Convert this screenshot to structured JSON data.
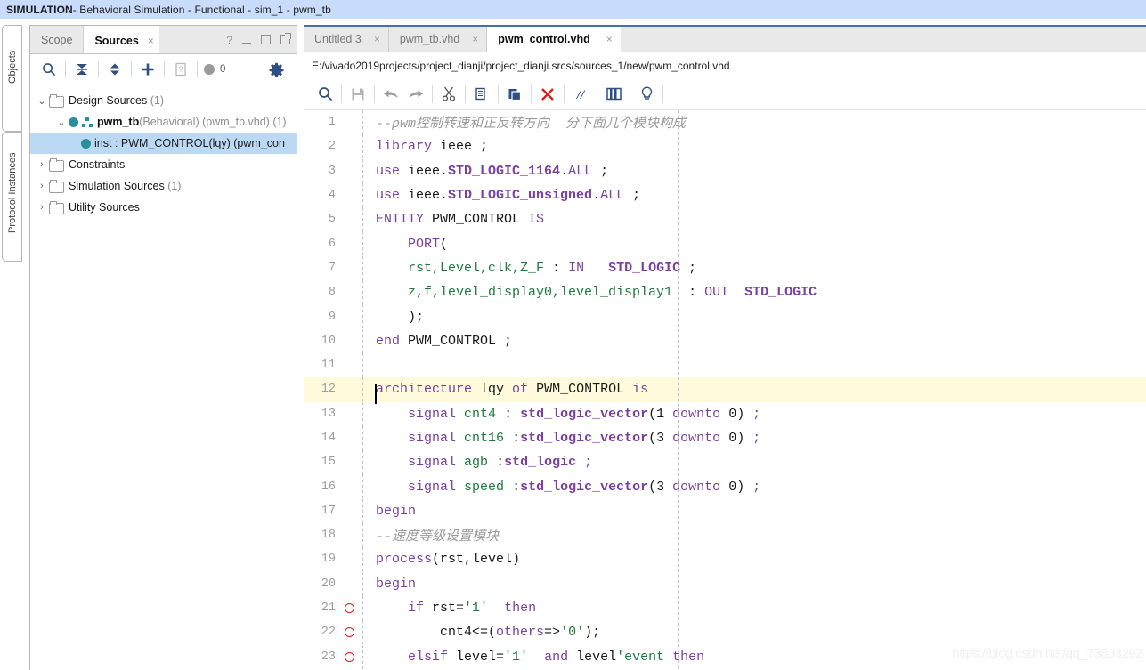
{
  "titlebar": {
    "app": "SIMULATION",
    "rest": " - Behavioral Simulation - Functional - sim_1 - pwm_tb"
  },
  "vertical_tabs": [
    {
      "label": "Objects"
    },
    {
      "label": "Protocol Instances"
    }
  ],
  "sources_panel": {
    "tabs": [
      {
        "label": "Scope",
        "active": false
      },
      {
        "label": "Sources",
        "active": true,
        "close": "×"
      }
    ],
    "window_buttons": {
      "help": "?",
      "minimize": "_",
      "maximize": "□",
      "float": "⧉"
    },
    "toolbar": {
      "search_icon": "search-icon",
      "collapse_icon": "collapse-all-icon",
      "expand_icon": "expand-all-icon",
      "add_icon": "add-sources-icon",
      "report_icon": "report-icon",
      "status_count": "0",
      "gear_icon": "settings-gear-icon"
    },
    "tree": [
      {
        "label": "Design Sources",
        "count": "(1)",
        "chevron": "⌄",
        "icon": "folder-icon",
        "indent": 1,
        "selected": false
      },
      {
        "label_bold": "pwm_tb",
        "label_gray": "(Behavioral) (pwm_tb.vhd)",
        "count": "(1)",
        "chevron": "⌄",
        "icon": "hierarchy-icon",
        "indent": 2,
        "selected": false
      },
      {
        "label": "inst : PWM_CONTROL(lqy) (pwm_con",
        "chevron": "",
        "icon": "instance-dot-icon",
        "indent": 3,
        "selected": true
      },
      {
        "label": "Constraints",
        "count": "",
        "chevron": "›",
        "icon": "folder-icon",
        "indent": 1,
        "selected": false
      },
      {
        "label": "Simulation Sources",
        "count": "(1)",
        "chevron": "›",
        "icon": "folder-icon",
        "indent": 1,
        "selected": false
      },
      {
        "label": "Utility Sources",
        "count": "",
        "chevron": "›",
        "icon": "folder-icon",
        "indent": 1,
        "selected": false
      }
    ]
  },
  "editor": {
    "tabs": [
      {
        "label": "Untitled 3",
        "active": false,
        "close": "×"
      },
      {
        "label": "pwm_tb.vhd",
        "active": false,
        "close": "×"
      },
      {
        "label": "pwm_control.vhd",
        "active": true,
        "close": "×"
      }
    ],
    "path": "E:/vivado2019projects/project_dianji/project_dianji.srcs/sources_1/new/pwm_control.vhd",
    "toolbar": [
      {
        "name": "find-icon"
      },
      {
        "name": "save-icon"
      },
      {
        "name": "undo-icon"
      },
      {
        "name": "redo-icon"
      },
      {
        "name": "cut-icon"
      },
      {
        "name": "copy-icon"
      },
      {
        "name": "paste-icon"
      },
      {
        "name": "delete-icon"
      },
      {
        "name": "comment-icon"
      },
      {
        "name": "indent-icon"
      },
      {
        "name": "hint-icon"
      }
    ],
    "highlight_line": 12,
    "lines": [
      {
        "n": 1,
        "bp": false,
        "tokens": [
          {
            "t": "--pwm控制转速和正反转方向  分下面几个模块构成",
            "c": "cmt"
          }
        ]
      },
      {
        "n": 2,
        "bp": false,
        "tokens": [
          {
            "t": "library",
            "c": "kw"
          },
          {
            "t": " ieee ;",
            "c": "pl"
          }
        ]
      },
      {
        "n": 3,
        "bp": false,
        "tokens": [
          {
            "t": "use",
            "c": "kw"
          },
          {
            "t": " ieee.",
            "c": "pl"
          },
          {
            "t": "STD_LOGIC_1164",
            "c": "kwb"
          },
          {
            "t": ".",
            "c": "pl"
          },
          {
            "t": "ALL",
            "c": "kw"
          },
          {
            "t": " ;",
            "c": "pl"
          }
        ]
      },
      {
        "n": 4,
        "bp": false,
        "tokens": [
          {
            "t": "use",
            "c": "kw"
          },
          {
            "t": " ieee.",
            "c": "pl"
          },
          {
            "t": "STD_LOGIC_unsigned",
            "c": "kwb"
          },
          {
            "t": ".",
            "c": "pl"
          },
          {
            "t": "ALL",
            "c": "kw"
          },
          {
            "t": " ;",
            "c": "pl"
          }
        ]
      },
      {
        "n": 5,
        "bp": false,
        "tokens": [
          {
            "t": "ENTITY",
            "c": "kw"
          },
          {
            "t": " PWM_CONTROL ",
            "c": "pl"
          },
          {
            "t": "IS",
            "c": "kw"
          }
        ]
      },
      {
        "n": 6,
        "bp": false,
        "tokens": [
          {
            "t": "    ",
            "c": "pl"
          },
          {
            "t": "PORT",
            "c": "kw"
          },
          {
            "t": "(",
            "c": "pl"
          }
        ]
      },
      {
        "n": 7,
        "bp": false,
        "tokens": [
          {
            "t": "    ",
            "c": "pl"
          },
          {
            "t": "rst,Level,clk,Z_F",
            "c": "id"
          },
          {
            "t": " : ",
            "c": "pl"
          },
          {
            "t": "IN",
            "c": "kw"
          },
          {
            "t": "   ",
            "c": "pl"
          },
          {
            "t": "STD_LOGIC",
            "c": "kwb"
          },
          {
            "t": " ;",
            "c": "pl"
          }
        ]
      },
      {
        "n": 8,
        "bp": false,
        "tokens": [
          {
            "t": "    ",
            "c": "pl"
          },
          {
            "t": "z,f,level_display0,level_display1",
            "c": "id"
          },
          {
            "t": "  : ",
            "c": "pl"
          },
          {
            "t": "OUT",
            "c": "kw"
          },
          {
            "t": "  ",
            "c": "pl"
          },
          {
            "t": "STD_LOGIC",
            "c": "kwb"
          }
        ]
      },
      {
        "n": 9,
        "bp": false,
        "tokens": [
          {
            "t": "    );",
            "c": "pl"
          }
        ]
      },
      {
        "n": 10,
        "bp": false,
        "tokens": [
          {
            "t": "end",
            "c": "kw"
          },
          {
            "t": " PWM_CONTROL ;",
            "c": "pl"
          }
        ]
      },
      {
        "n": 11,
        "bp": false,
        "tokens": [
          {
            "t": "",
            "c": "pl"
          }
        ]
      },
      {
        "n": 12,
        "bp": false,
        "tokens": [
          {
            "t": "architecture",
            "c": "kw"
          },
          {
            "t": " lqy ",
            "c": "pl"
          },
          {
            "t": "of",
            "c": "kw"
          },
          {
            "t": " PWM_CONTROL ",
            "c": "pl"
          },
          {
            "t": "is",
            "c": "kw"
          }
        ]
      },
      {
        "n": 13,
        "bp": false,
        "tokens": [
          {
            "t": "    ",
            "c": "pl"
          },
          {
            "t": "signal",
            "c": "kw"
          },
          {
            "t": " ",
            "c": "pl"
          },
          {
            "t": "cnt4",
            "c": "id"
          },
          {
            "t": " : ",
            "c": "pl"
          },
          {
            "t": "std_logic_vector",
            "c": "kwb"
          },
          {
            "t": "(",
            "c": "pl"
          },
          {
            "t": "1",
            "c": "num"
          },
          {
            "t": " ",
            "c": "pl"
          },
          {
            "t": "downto",
            "c": "kw"
          },
          {
            "t": " ",
            "c": "pl"
          },
          {
            "t": "0",
            "c": "num"
          },
          {
            "t": ") ",
            "c": "pl"
          },
          {
            "t": ";",
            "c": "kw"
          }
        ]
      },
      {
        "n": 14,
        "bp": false,
        "tokens": [
          {
            "t": "    ",
            "c": "pl"
          },
          {
            "t": "signal",
            "c": "kw"
          },
          {
            "t": " ",
            "c": "pl"
          },
          {
            "t": "cnt16",
            "c": "id"
          },
          {
            "t": " :",
            "c": "pl"
          },
          {
            "t": "std_logic_vector",
            "c": "kwb"
          },
          {
            "t": "(",
            "c": "pl"
          },
          {
            "t": "3",
            "c": "num"
          },
          {
            "t": " ",
            "c": "pl"
          },
          {
            "t": "downto",
            "c": "kw"
          },
          {
            "t": " ",
            "c": "pl"
          },
          {
            "t": "0",
            "c": "num"
          },
          {
            "t": ") ",
            "c": "pl"
          },
          {
            "t": ";",
            "c": "kw"
          }
        ]
      },
      {
        "n": 15,
        "bp": false,
        "tokens": [
          {
            "t": "    ",
            "c": "pl"
          },
          {
            "t": "signal",
            "c": "kw"
          },
          {
            "t": " ",
            "c": "pl"
          },
          {
            "t": "agb",
            "c": "id"
          },
          {
            "t": " :",
            "c": "pl"
          },
          {
            "t": "std_logic",
            "c": "kwb"
          },
          {
            "t": " ",
            "c": "pl"
          },
          {
            "t": ";",
            "c": "kw"
          }
        ]
      },
      {
        "n": 16,
        "bp": false,
        "tokens": [
          {
            "t": "    ",
            "c": "pl"
          },
          {
            "t": "signal",
            "c": "kw"
          },
          {
            "t": " ",
            "c": "pl"
          },
          {
            "t": "speed",
            "c": "id"
          },
          {
            "t": " :",
            "c": "pl"
          },
          {
            "t": "std_logic_vector",
            "c": "kwb"
          },
          {
            "t": "(",
            "c": "pl"
          },
          {
            "t": "3",
            "c": "num"
          },
          {
            "t": " ",
            "c": "pl"
          },
          {
            "t": "downto",
            "c": "kw"
          },
          {
            "t": " ",
            "c": "pl"
          },
          {
            "t": "0",
            "c": "num"
          },
          {
            "t": ") ",
            "c": "pl"
          },
          {
            "t": ";",
            "c": "kw"
          }
        ]
      },
      {
        "n": 17,
        "bp": false,
        "tokens": [
          {
            "t": "begin",
            "c": "kw"
          }
        ]
      },
      {
        "n": 18,
        "bp": false,
        "tokens": [
          {
            "t": "--速度等级设置模块",
            "c": "cmt"
          }
        ]
      },
      {
        "n": 19,
        "bp": false,
        "tokens": [
          {
            "t": "process",
            "c": "kw"
          },
          {
            "t": "(rst,level)",
            "c": "pl"
          }
        ]
      },
      {
        "n": 20,
        "bp": false,
        "tokens": [
          {
            "t": "begin",
            "c": "kw"
          }
        ]
      },
      {
        "n": 21,
        "bp": true,
        "tokens": [
          {
            "t": "    ",
            "c": "pl"
          },
          {
            "t": "if",
            "c": "kw"
          },
          {
            "t": " rst=",
            "c": "pl"
          },
          {
            "t": "'1'",
            "c": "id"
          },
          {
            "t": "  ",
            "c": "pl"
          },
          {
            "t": "then",
            "c": "kw"
          }
        ]
      },
      {
        "n": 22,
        "bp": true,
        "tokens": [
          {
            "t": "        cnt4<=(",
            "c": "pl"
          },
          {
            "t": "others",
            "c": "kw"
          },
          {
            "t": "=>",
            "c": "pl"
          },
          {
            "t": "'0'",
            "c": "id"
          },
          {
            "t": ");",
            "c": "pl"
          }
        ]
      },
      {
        "n": 23,
        "bp": true,
        "tokens": [
          {
            "t": "    ",
            "c": "pl"
          },
          {
            "t": "elsif",
            "c": "kw"
          },
          {
            "t": " level=",
            "c": "pl"
          },
          {
            "t": "'1'",
            "c": "id"
          },
          {
            "t": "  ",
            "c": "pl"
          },
          {
            "t": "and",
            "c": "kw"
          },
          {
            "t": " level",
            "c": "pl"
          },
          {
            "t": "'event",
            "c": "id"
          },
          {
            "t": " ",
            "c": "pl"
          },
          {
            "t": "then",
            "c": "kw"
          }
        ]
      }
    ]
  },
  "watermark": "https://blog.csdn.net/qq_73803292"
}
